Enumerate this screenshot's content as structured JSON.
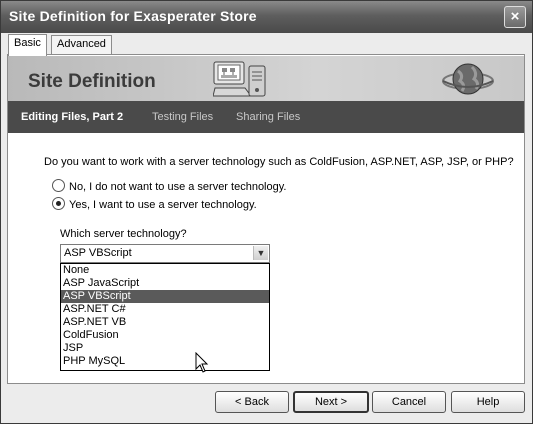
{
  "window": {
    "title": "Site Definition for Exasperater Store",
    "close_label": "×"
  },
  "tabs": [
    {
      "label": "Basic"
    },
    {
      "label": "Advanced"
    }
  ],
  "banner": {
    "title": "Site Definition"
  },
  "steps": [
    {
      "label": "Editing Files, Part 2"
    },
    {
      "label": "Testing Files"
    },
    {
      "label": "Sharing Files"
    }
  ],
  "form": {
    "question": "Do you want to work with a server technology such as ColdFusion, ASP.NET, ASP, JSP, or PHP?",
    "radio_no": "No, I do not want to use a server technology.",
    "radio_yes": "Yes, I want to use a server technology.",
    "which_label": "Which server technology?",
    "selected_value": "ASP VBScript",
    "options": [
      "None",
      "ASP JavaScript",
      "ASP VBScript",
      "ASP.NET C#",
      "ASP.NET VB",
      "ColdFusion",
      "JSP",
      "PHP MySQL"
    ]
  },
  "buttons": {
    "back": "< Back",
    "next": "Next >",
    "cancel": "Cancel",
    "help": "Help"
  }
}
